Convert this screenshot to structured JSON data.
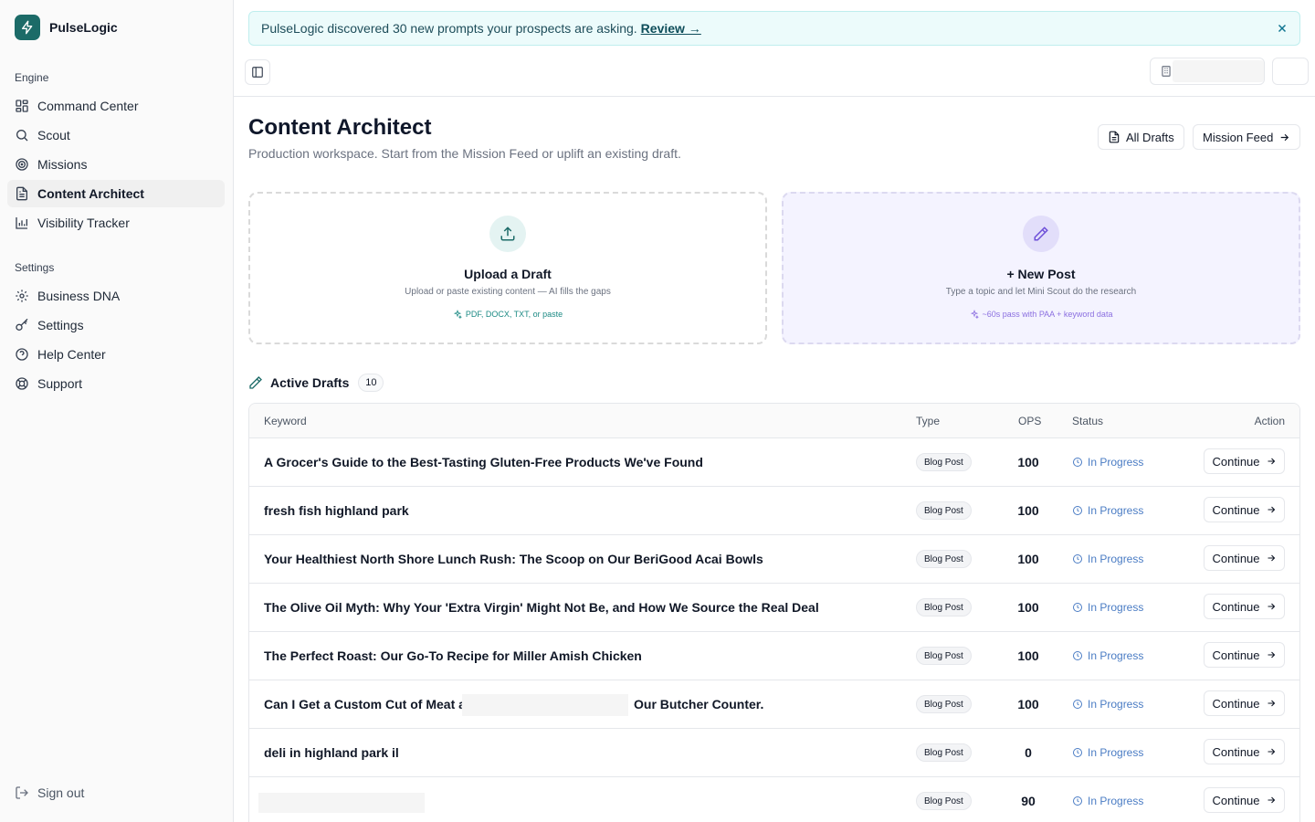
{
  "brand": {
    "name": "PulseLogic"
  },
  "nav": {
    "engine_label": "Engine",
    "engine_items": [
      {
        "label": "Command Center",
        "icon": "grid-icon"
      },
      {
        "label": "Scout",
        "icon": "search-icon"
      },
      {
        "label": "Missions",
        "icon": "target-icon"
      },
      {
        "label": "Content Architect",
        "icon": "document-icon",
        "active": true
      },
      {
        "label": "Visibility Tracker",
        "icon": "bar-chart-icon"
      }
    ],
    "settings_label": "Settings",
    "settings_items": [
      {
        "label": "Business DNA",
        "icon": "gear-icon"
      },
      {
        "label": "Settings",
        "icon": "key-icon"
      },
      {
        "label": "Help Center",
        "icon": "help-icon"
      },
      {
        "label": "Support",
        "icon": "lifebuoy-icon"
      }
    ],
    "sign_out": "Sign out"
  },
  "banner": {
    "text": "PulseLogic discovered 30 new prompts your prospects are asking.",
    "link": "Review →"
  },
  "page": {
    "title": "Content Architect",
    "subtitle": "Production workspace. Start from the Mission Feed or uplift an existing draft.",
    "all_drafts": "All Drafts",
    "mission_feed": "Mission Feed"
  },
  "cards": {
    "upload": {
      "title": "Upload a Draft",
      "desc": "Upload or paste existing content — AI fills the gaps",
      "hint": "PDF, DOCX, TXT, or paste"
    },
    "new_post": {
      "title": "+ New Post",
      "desc": "Type a topic and let Mini Scout do the research",
      "hint": "~60s pass with PAA + keyword data"
    }
  },
  "drafts": {
    "title": "Active Drafts",
    "count": "10",
    "columns": {
      "keyword": "Keyword",
      "type": "Type",
      "ops": "OPS",
      "status": "Status",
      "action": "Action"
    },
    "rows": [
      {
        "keyword": "A Grocer's Guide to the Best-Tasting Gluten-Free Products We've Found",
        "type": "Blog Post",
        "ops": "100",
        "status": "In Progress",
        "action": "Continue"
      },
      {
        "keyword": "fresh fish highland park",
        "type": "Blog Post",
        "ops": "100",
        "status": "In Progress",
        "action": "Continue"
      },
      {
        "keyword": "Your Healthiest North Shore Lunch Rush: The Scoop on Our BeriGood Acai Bowls",
        "type": "Blog Post",
        "ops": "100",
        "status": "In Progress",
        "action": "Continue"
      },
      {
        "keyword": "The Olive Oil Myth: Why Your 'Extra Virgin' Might Not Be, and How We Source the Real Deal",
        "type": "Blog Post",
        "ops": "100",
        "status": "In Progress",
        "action": "Continue"
      },
      {
        "keyword": "The Perfect Roast: Our Go-To Recipe for Miller Amish Chicken",
        "type": "Blog Post",
        "ops": "100",
        "status": "In Progress",
        "action": "Continue"
      },
      {
        "keyword": "Can I Get a Custom Cut of Meat at",
        "keyword_tail": "Our Butcher Counter.",
        "type": "Blog Post",
        "ops": "100",
        "status": "In Progress",
        "action": "Continue"
      },
      {
        "keyword": "deli in highland park il",
        "type": "Blog Post",
        "ops": "0",
        "status": "In Progress",
        "action": "Continue"
      },
      {
        "keyword": "",
        "type": "Blog Post",
        "ops": "90",
        "status": "In Progress",
        "action": "Continue"
      }
    ]
  }
}
